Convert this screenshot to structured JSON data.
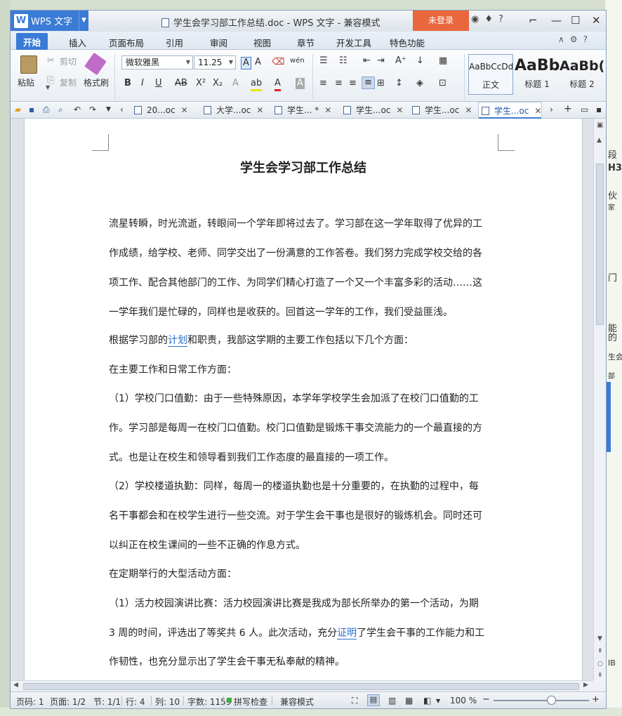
{
  "app": {
    "name": "WPS 文字",
    "window_title": "学生会学习部工作总结.doc - WPS 文字 - 兼容模式",
    "login": "未登录"
  },
  "ribbon_tabs": [
    "开始",
    "插入",
    "页面布局",
    "引用",
    "审阅",
    "视图",
    "章节",
    "开发工具",
    "特色功能"
  ],
  "clipboard": {
    "paste": "粘贴",
    "cut": "剪切",
    "copy": "复制",
    "format_painter": "格式刷"
  },
  "font": {
    "family": "微软雅黑",
    "size": "11.25"
  },
  "styles": [
    {
      "preview": "AaBbCcDd",
      "label": "正文"
    },
    {
      "preview": "AaBb",
      "label": "标题 1"
    },
    {
      "preview": "AaBb(",
      "label": "标题 2"
    }
  ],
  "doc_tabs": [
    "20...oc",
    "大学...oc",
    "学生... *",
    "学生...oc",
    "学生...oc",
    "学生...oc"
  ],
  "document": {
    "title": "学生会学习部工作总结",
    "lines": [
      "流星转瞬，时光流逝，转眼间一个学年即将过去了。学习部在这一学年取得了优异的工",
      "作成绩，给学校、老师、同学交出了一份满意的工作答卷。我们努力完成学校交给的各",
      "项工作、配合其他部门的工作、为同学们精心打造了一个又一个丰富多彩的活动……这",
      "一学年我们是忙碌的，同样也是收获的。回首这一学年的工作，我们受益匪浅。",
      "",
      "和职责，我部这学期的主要工作包括以下几个方面：",
      "在主要工作和日常工作方面：",
      "（1）学校门口值勤：由于一些特殊原因，本学年学校学生会加派了在校门口值勤的工",
      "作。学习部是每周一在校门口值勤。校门口值勤是锻炼干事交流能力的一个最直接的方",
      "式。也是让在校生和领导看到我们工作态度的最直接的一项工作。",
      "（2）学校楼道执勤：同样，每周一的楼道执勤也是十分重要的，在执勤的过程中，每",
      "名干事都会和在校学生进行一些交流。对于学生会干事也是很好的锻炼机会。同时还可",
      "以纠正在校生课间的一些不正确的作息方式。",
      "在定期举行的大型活动方面：",
      "（1）活力校园演讲比赛：活力校园演讲比赛是我成为部长所举办的第一个活动，为期",
      "",
      "作韧性，也充分显示出了学生会干事无私奉献的精神。"
    ],
    "line5_pre": "根据学习部的",
    "line5_link": "计划",
    "line16_pre": "3 周的时间，评选出了等奖共 6 人。此次活动，充分",
    "line16_link": "证明",
    "line16_post": "了学生会干事的工作能力和工"
  },
  "status": {
    "page": "页码: 1",
    "pages": "页面: 1/2",
    "section": "节: 1/1",
    "row": "行: 4",
    "col": "列: 10",
    "words": "字数: 1159",
    "spell": "拼写检查",
    "mode": "兼容模式",
    "zoom": "100 %",
    "zoom_level": 0.6
  },
  "background": [
    "段",
    "H3",
    "伙",
    "家",
    "门",
    "能",
    "的",
    "生会",
    "部",
    "IB"
  ]
}
